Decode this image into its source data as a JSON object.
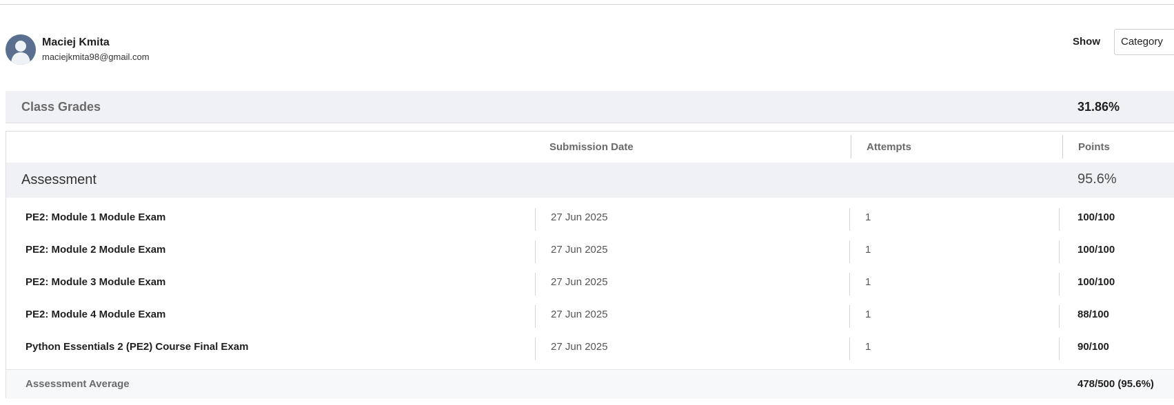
{
  "user": {
    "name": "Maciej Kmita",
    "email": "maciejkmita98@gmail.com"
  },
  "controls": {
    "show_label": "Show",
    "category_select_value": "Category"
  },
  "summary": {
    "label": "Class Grades",
    "value": "31.86%"
  },
  "table": {
    "headers": {
      "submission_date": "Submission Date",
      "attempts": "Attempts",
      "points": "Points"
    },
    "category": {
      "name": "Assessment",
      "percent": "95.6%"
    },
    "rows": [
      {
        "name": "PE2: Module 1 Module Exam",
        "date": "27 Jun 2025",
        "attempts": "1",
        "points": "100/100"
      },
      {
        "name": "PE2: Module 2 Module Exam",
        "date": "27 Jun 2025",
        "attempts": "1",
        "points": "100/100"
      },
      {
        "name": "PE2: Module 3 Module Exam",
        "date": "27 Jun 2025",
        "attempts": "1",
        "points": "100/100"
      },
      {
        "name": "PE2: Module 4 Module Exam",
        "date": "27 Jun 2025",
        "attempts": "1",
        "points": "88/100"
      },
      {
        "name": "Python Essentials 2 (PE2) Course Final Exam",
        "date": "27 Jun 2025",
        "attempts": "1",
        "points": "90/100"
      }
    ],
    "average": {
      "label": "Assessment Average",
      "value": "478/500 (95.6%)"
    }
  },
  "colors": {
    "avatar_bg": "#5a6e8f",
    "band_bg": "#f0f1f5",
    "muted_text": "#6a6a6a"
  },
  "icons": {
    "avatar": "user-silhouette-icon"
  }
}
